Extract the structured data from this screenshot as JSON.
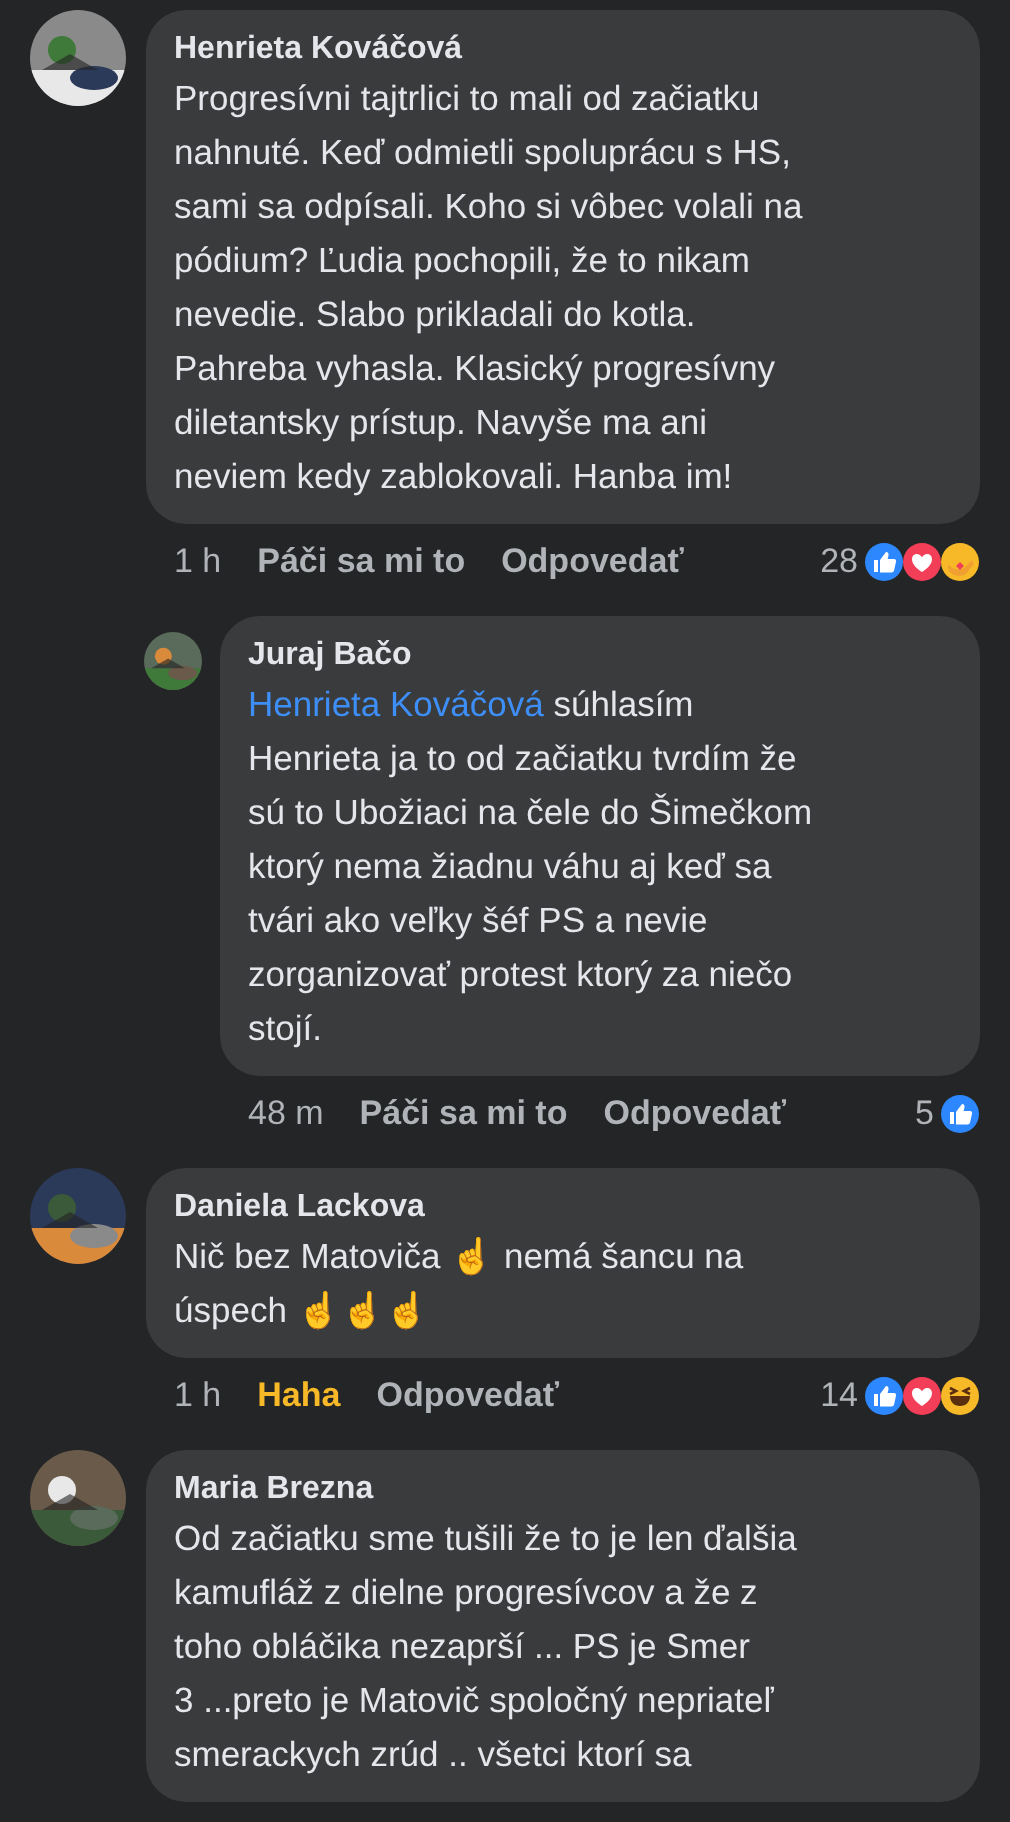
{
  "comments": [
    {
      "author": "Henrieta Kováčová",
      "reply": false,
      "avatar": {
        "kind": "picture"
      },
      "text": "Progresívni tajtrlici to mali od začiatku\nnahnuté. Keď odmietli spoluprácu s HS,\nsami sa odpísali. Koho si vôbec volali na\npódium? Ľudia pochopili, že to nikam\nnevedie. Slabo prikladali do kotla.\nPahreba vyhasla. Klasický progresívny\ndiletantsky prístup. Navyše ma ani\nneviem kedy zablokovali. Hanba im!",
      "time": "1 h",
      "like_action": {
        "label": "Páči sa mi to",
        "reacted": false
      },
      "reply_action": "Odpovedať",
      "reaction_count": "28",
      "reactions": [
        {
          "kind": "like"
        },
        {
          "kind": "love"
        },
        {
          "kind": "care"
        }
      ]
    },
    {
      "author": "Juraj Bačo",
      "reply": true,
      "avatar": {
        "kind": "picture"
      },
      "mention": "Henrieta Kováčová",
      "text": " súhlasím\nHenrieta ja to od začiatku tvrdím že\nsú to Ubožiaci na čele do Šimečkom\nktorý nema žiadnu váhu  aj keď sa\ntvári ako veľky šéf PS a nevie\nzorganizovať protest ktorý za niečo\nstojí.",
      "time": "48 m",
      "like_action": {
        "label": "Páči sa mi to",
        "reacted": false
      },
      "reply_action": "Odpovedať",
      "reaction_count": "5",
      "reactions": [
        {
          "kind": "like"
        }
      ]
    },
    {
      "author": "Daniela Lackova",
      "reply": false,
      "avatar": {
        "kind": "picture"
      },
      "text": "Nič bez Matoviča ☝️ nemá šancu na\núspech ☝️☝️☝️",
      "time": "1 h",
      "like_action": {
        "label": "Haha",
        "reacted": true
      },
      "reply_action": "Odpovedať",
      "reaction_count": "14",
      "reactions": [
        {
          "kind": "like"
        },
        {
          "kind": "love"
        },
        {
          "kind": "haha"
        }
      ]
    },
    {
      "author": "Maria Brezna",
      "reply": false,
      "avatar": {
        "kind": "picture"
      },
      "text": "Od začiatku sme tušili že to je len ďalšia\nkamufláž z dielne progresívcov  a že z\ntoho obláčika nezaprší ... PS je Smer\n3 ...preto je Matovič spoločný nepriateľ\nsmerackych zrúd ..  všetci ktorí sa"
    }
  ]
}
